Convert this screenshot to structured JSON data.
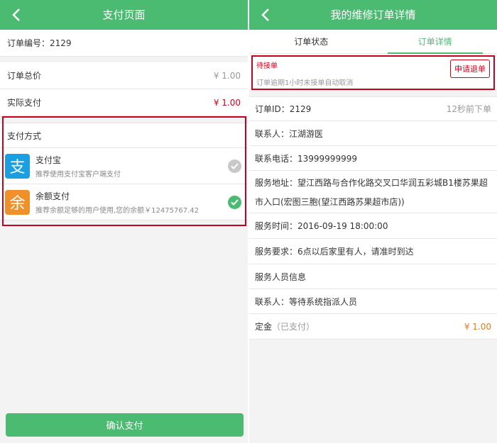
{
  "left": {
    "title": "支付页面",
    "order_no": "订单编号：2129",
    "total_label": "订单总价",
    "total_value": "¥ 1.00",
    "actual_label": "实际支付",
    "actual_value": "¥ 1.00",
    "method_title": "支付方式",
    "methods": [
      {
        "name": "支付宝",
        "desc": "推荐使用支付宝客户端支付",
        "logo_char": "支",
        "color": "#1a9fe0",
        "checked": false
      },
      {
        "name": "余额支付",
        "desc": "推荐余额足够的用户使用,您的余额￥12475767.42",
        "logo_char": "余",
        "color": "#f0902a",
        "checked": true
      }
    ],
    "confirm_label": "确认支付"
  },
  "right": {
    "title": "我的维修订单详情",
    "tabs": [
      "订单状态",
      "订单详情"
    ],
    "active_tab": 1,
    "status": "待接单",
    "status_desc": "订单逾期1小时未接单自动取消",
    "refund_label": "申请退单",
    "order_id": "订单ID：2129",
    "order_time": "12秒前下单",
    "contact": "联系人：江湖游医",
    "phone": "联系电话：13999999999",
    "address": "服务地址：望江西路与合作化路交叉口华润五彩城B1楼苏果超市入口(宏图三胞(望江西路苏果超市店))",
    "service_time": "服务时间：2016-09-19 18:00:00",
    "requirement": "服务要求：6点以后家里有人，请准时到达",
    "staff_title": "服务人员信息",
    "staff_contact": "联系人：等待系统指派人员",
    "deposit_label": "定金",
    "deposit_status": "（已支付）",
    "deposit_value": "¥ 1.00"
  },
  "colors": {
    "brand": "#4cbb72",
    "alert": "#d0021b",
    "price_orange": "#e07b1f"
  }
}
